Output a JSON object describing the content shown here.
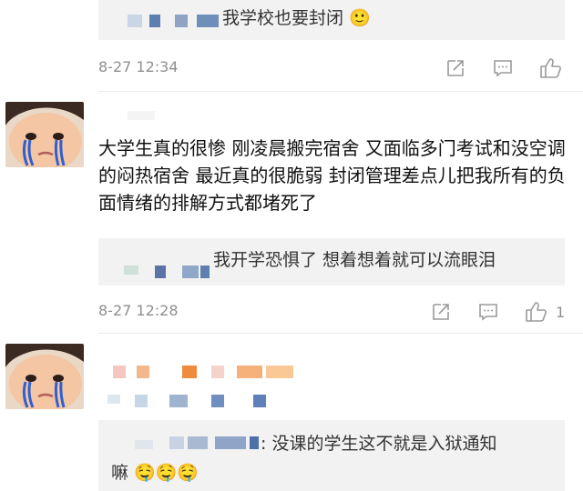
{
  "top_reply": {
    "text": "我学校也要封闭 🙂",
    "time": "8-27 12:34",
    "likes": ""
  },
  "comment1": {
    "text": "大学生真的很惨 刚凌晨搬完宿舍 又面临多门考试和没空调的闷热宿舍 最近真的很脆弱 封闭管理差点儿把我所有的负面情绪的排解方式都堵死了",
    "reply_text": "我开学恐惧了 想着想着就可以流眼泪",
    "time": "8-27 12:28",
    "likes": "1"
  },
  "comment2": {
    "reply_text": ": 没课的学生这不就是入狱通知",
    "reply_text2": "嘛 🤤🤤🤤"
  },
  "icons": {
    "share": "share-icon",
    "comment": "comment-icon",
    "like": "thumbs-up-icon"
  },
  "colors": {
    "reply_bg": "#f2f2f2",
    "meta_gray": "#8f8f8f",
    "icon_gray": "#9a9a9a"
  }
}
